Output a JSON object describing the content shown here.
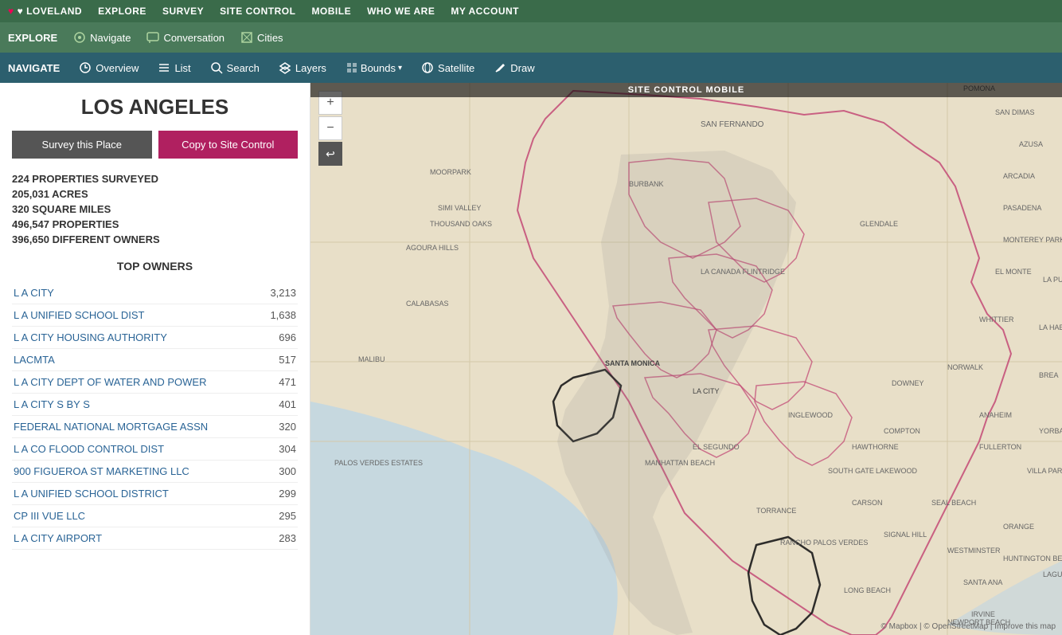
{
  "topNav": {
    "brand": "♥ LOVELAND",
    "items": [
      "EXPLORE",
      "SURVEY",
      "SITE CONTROL",
      "MOBILE",
      "WHO WE ARE",
      "MY ACCOUNT"
    ]
  },
  "secondNav": {
    "exploreLabel": "EXPLORE",
    "items": [
      {
        "icon": "navigate-icon",
        "label": "Navigate"
      },
      {
        "icon": "conversation-icon",
        "label": "Conversation"
      },
      {
        "icon": "cities-icon",
        "label": "Cities"
      }
    ]
  },
  "siteControlBanner": "SITE CONTROL MOBILE",
  "thirdNav": {
    "navigateLabel": "NAVIGATE",
    "items": [
      {
        "icon": "overview-icon",
        "label": "Overview"
      },
      {
        "icon": "list-icon",
        "label": "List"
      },
      {
        "icon": "search-icon",
        "label": "Search"
      },
      {
        "icon": "layers-icon",
        "label": "Layers"
      },
      {
        "icon": "bounds-icon",
        "label": "Bounds",
        "hasDropdown": true
      },
      {
        "icon": "satellite-icon",
        "label": "Satellite"
      },
      {
        "icon": "draw-icon",
        "label": "Draw"
      }
    ]
  },
  "sidebar": {
    "cityName": "LOS ANGELES",
    "buttons": {
      "survey": "Survey this Place",
      "copy": "Copy to Site Control"
    },
    "stats": [
      "224 PROPERTIES SURVEYED",
      "205,031 ACRES",
      "320 SQUARE MILES",
      "496,547 PROPERTIES",
      "396,650 DIFFERENT OWNERS"
    ],
    "topOwnersTitle": "TOP OWNERS",
    "owners": [
      {
        "name": "L A CITY",
        "count": "3,213"
      },
      {
        "name": "L A UNIFIED SCHOOL DIST",
        "count": "1,638"
      },
      {
        "name": "L A CITY HOUSING AUTHORITY",
        "count": "696"
      },
      {
        "name": "LACMTA",
        "count": "517"
      },
      {
        "name": "L A CITY DEPT OF WATER AND POWER",
        "count": "471"
      },
      {
        "name": "L A CITY S BY S",
        "count": "401"
      },
      {
        "name": "FEDERAL NATIONAL MORTGAGE ASSN",
        "count": "320"
      },
      {
        "name": "L A CO FLOOD CONTROL DIST",
        "count": "304"
      },
      {
        "name": "900 FIGUEROA ST MARKETING LLC",
        "count": "300"
      },
      {
        "name": "L A UNIFIED SCHOOL DISTRICT",
        "count": "299"
      },
      {
        "name": "CP III VUE LLC",
        "count": "295"
      },
      {
        "name": "L A CITY AIRPORT",
        "count": "283"
      }
    ]
  },
  "map": {
    "zoomIn": "+",
    "zoomOut": "−",
    "backArrow": "↩",
    "attribution": "© Mapbox | © OpenStreetMap | Improve this map"
  },
  "colors": {
    "topNavBg": "#3a6b4a",
    "secondNavBg": "#4a7a5a",
    "thirdNavBg": "#2c5f6e",
    "btnSurvey": "#555555",
    "btnCopy": "#b02060",
    "ownerLink": "#2a6496"
  }
}
